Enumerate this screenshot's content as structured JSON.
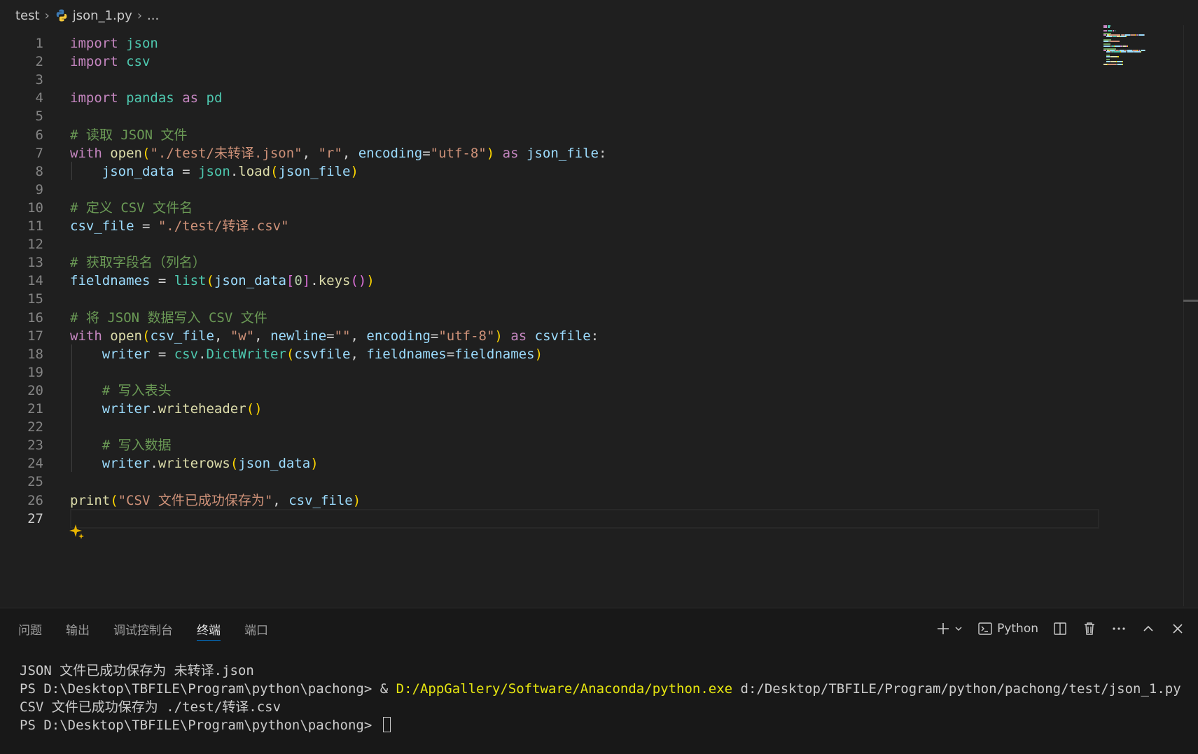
{
  "breadcrumb": {
    "folder": "test",
    "file": "json_1.py",
    "more": "..."
  },
  "editor": {
    "active_line": 27,
    "lines": [
      {
        "n": "1",
        "tokens": [
          [
            "import",
            "kw"
          ],
          [
            " ",
            "wh"
          ],
          [
            "json",
            "mod"
          ]
        ]
      },
      {
        "n": "2",
        "tokens": [
          [
            "import",
            "kw"
          ],
          [
            " ",
            "wh"
          ],
          [
            "csv",
            "mod"
          ]
        ]
      },
      {
        "n": "3",
        "tokens": []
      },
      {
        "n": "4",
        "tokens": [
          [
            "import",
            "kw"
          ],
          [
            " ",
            "wh"
          ],
          [
            "pandas",
            "mod"
          ],
          [
            " ",
            "wh"
          ],
          [
            "as",
            "kw"
          ],
          [
            " ",
            "wh"
          ],
          [
            "pd",
            "mod"
          ]
        ]
      },
      {
        "n": "5",
        "tokens": []
      },
      {
        "n": "6",
        "tokens": [
          [
            "# 读取 JSON 文件",
            "cm"
          ]
        ]
      },
      {
        "n": "7",
        "tokens": [
          [
            "with",
            "kw"
          ],
          [
            " ",
            "wh"
          ],
          [
            "open",
            "fn"
          ],
          [
            "(",
            "p1"
          ],
          [
            "\"./test/未转译.json\"",
            "str"
          ],
          [
            ", ",
            "op"
          ],
          [
            "\"r\"",
            "str"
          ],
          [
            ", ",
            "op"
          ],
          [
            "encoding",
            "var"
          ],
          [
            "=",
            "op"
          ],
          [
            "\"utf-8\"",
            "str"
          ],
          [
            ")",
            "p1"
          ],
          [
            " ",
            "wh"
          ],
          [
            "as",
            "kw"
          ],
          [
            " ",
            "wh"
          ],
          [
            "json_file",
            "var"
          ],
          [
            ":",
            "op"
          ]
        ]
      },
      {
        "n": "8",
        "tokens": [
          [
            "    ",
            "wh"
          ],
          [
            "json_data",
            "var"
          ],
          [
            " = ",
            "op"
          ],
          [
            "json",
            "mod"
          ],
          [
            ".",
            "op"
          ],
          [
            "load",
            "fn"
          ],
          [
            "(",
            "p1"
          ],
          [
            "json_file",
            "var"
          ],
          [
            ")",
            "p1"
          ]
        ]
      },
      {
        "n": "9",
        "tokens": []
      },
      {
        "n": "10",
        "tokens": [
          [
            "# 定义 CSV 文件名",
            "cm"
          ]
        ]
      },
      {
        "n": "11",
        "tokens": [
          [
            "csv_file",
            "var"
          ],
          [
            " = ",
            "op"
          ],
          [
            "\"./test/转译.csv\"",
            "str"
          ]
        ]
      },
      {
        "n": "12",
        "tokens": []
      },
      {
        "n": "13",
        "tokens": [
          [
            "# 获取字段名（列名）",
            "cm"
          ]
        ]
      },
      {
        "n": "14",
        "tokens": [
          [
            "fieldnames",
            "var"
          ],
          [
            " = ",
            "op"
          ],
          [
            "list",
            "mod"
          ],
          [
            "(",
            "p1"
          ],
          [
            "json_data",
            "var"
          ],
          [
            "[",
            "p2"
          ],
          [
            "0",
            "num"
          ],
          [
            "]",
            "p2"
          ],
          [
            ".",
            "op"
          ],
          [
            "keys",
            "fn"
          ],
          [
            "()",
            "p2"
          ],
          [
            ")",
            "p1"
          ]
        ]
      },
      {
        "n": "15",
        "tokens": []
      },
      {
        "n": "16",
        "tokens": [
          [
            "# 将 JSON 数据写入 CSV 文件",
            "cm"
          ]
        ]
      },
      {
        "n": "17",
        "tokens": [
          [
            "with",
            "kw"
          ],
          [
            " ",
            "wh"
          ],
          [
            "open",
            "fn"
          ],
          [
            "(",
            "p1"
          ],
          [
            "csv_file",
            "var"
          ],
          [
            ", ",
            "op"
          ],
          [
            "\"w\"",
            "str"
          ],
          [
            ", ",
            "op"
          ],
          [
            "newline",
            "var"
          ],
          [
            "=",
            "op"
          ],
          [
            "\"\"",
            "str"
          ],
          [
            ", ",
            "op"
          ],
          [
            "encoding",
            "var"
          ],
          [
            "=",
            "op"
          ],
          [
            "\"utf-8\"",
            "str"
          ],
          [
            ")",
            "p1"
          ],
          [
            " ",
            "wh"
          ],
          [
            "as",
            "kw"
          ],
          [
            " ",
            "wh"
          ],
          [
            "csvfile",
            "var"
          ],
          [
            ":",
            "op"
          ]
        ]
      },
      {
        "n": "18",
        "tokens": [
          [
            "    ",
            "wh"
          ],
          [
            "writer",
            "var"
          ],
          [
            " = ",
            "op"
          ],
          [
            "csv",
            "mod"
          ],
          [
            ".",
            "op"
          ],
          [
            "DictWriter",
            "mod"
          ],
          [
            "(",
            "p1"
          ],
          [
            "csvfile",
            "var"
          ],
          [
            ", ",
            "op"
          ],
          [
            "fieldnames",
            "var"
          ],
          [
            "=",
            "op"
          ],
          [
            "fieldnames",
            "var"
          ],
          [
            ")",
            "p1"
          ]
        ]
      },
      {
        "n": "19",
        "tokens": []
      },
      {
        "n": "20",
        "tokens": [
          [
            "    ",
            "wh"
          ],
          [
            "# 写入表头",
            "cm"
          ]
        ]
      },
      {
        "n": "21",
        "tokens": [
          [
            "    ",
            "wh"
          ],
          [
            "writer",
            "var"
          ],
          [
            ".",
            "op"
          ],
          [
            "writeheader",
            "fn"
          ],
          [
            "()",
            "p1"
          ]
        ]
      },
      {
        "n": "22",
        "tokens": []
      },
      {
        "n": "23",
        "tokens": [
          [
            "    ",
            "wh"
          ],
          [
            "# 写入数据",
            "cm"
          ]
        ]
      },
      {
        "n": "24",
        "tokens": [
          [
            "    ",
            "wh"
          ],
          [
            "writer",
            "var"
          ],
          [
            ".",
            "op"
          ],
          [
            "writerows",
            "fn"
          ],
          [
            "(",
            "p1"
          ],
          [
            "json_data",
            "var"
          ],
          [
            ")",
            "p1"
          ]
        ]
      },
      {
        "n": "25",
        "tokens": []
      },
      {
        "n": "26",
        "tokens": [
          [
            "print",
            "fn"
          ],
          [
            "(",
            "p1"
          ],
          [
            "\"CSV 文件已成功保存为\"",
            "str"
          ],
          [
            ", ",
            "op"
          ],
          [
            "csv_file",
            "var"
          ],
          [
            ")",
            "p1"
          ]
        ]
      },
      {
        "n": "27",
        "tokens": []
      }
    ]
  },
  "panel": {
    "tabs": [
      {
        "label": "问题",
        "name": "tab-problems"
      },
      {
        "label": "输出",
        "name": "tab-output"
      },
      {
        "label": "调试控制台",
        "name": "tab-debug-console"
      },
      {
        "label": "终端",
        "name": "tab-terminal",
        "active": true
      },
      {
        "label": "端口",
        "name": "tab-ports"
      }
    ],
    "terminal_profile": "Python",
    "terminal_lines": [
      {
        "parts": [
          [
            "JSON 文件已成功保存为 未转译.json",
            "plain"
          ]
        ]
      },
      {
        "parts": [
          [
            "PS D:\\Desktop\\TBFILE\\Program\\python\\pachong> & ",
            "plain"
          ],
          [
            "D:/AppGallery/Software/Anaconda/python.exe",
            "yel"
          ],
          [
            " d:/Desktop/TBFILE/Program/python/pachong/test/json_1.py",
            "plain"
          ]
        ]
      },
      {
        "parts": [
          [
            "CSV 文件已成功保存为 ./test/转译.csv",
            "plain"
          ]
        ]
      },
      {
        "parts": [
          [
            "PS D:\\Desktop\\TBFILE\\Program\\python\\pachong> ",
            "plain"
          ]
        ],
        "caret": true
      }
    ]
  },
  "icons": {
    "python_file": "python-file-icon",
    "chevron": "chevron-right-icon",
    "sparkle": "sparkle-icon"
  },
  "colors": {
    "editor_bg": "#1f1f1f",
    "panel_bg": "#181818",
    "accent": "#0078d4",
    "keyword": "#c586c0",
    "module": "#4ec9b0",
    "variable": "#9cdcfe",
    "function": "#dcdcaa",
    "string": "#ce9178",
    "comment": "#6a9955"
  }
}
